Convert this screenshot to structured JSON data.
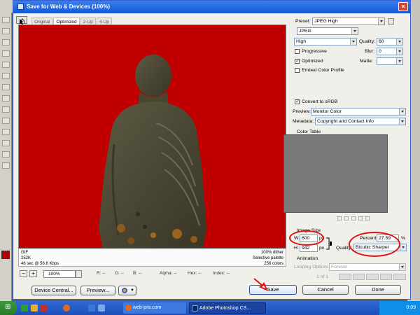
{
  "dialog": {
    "title": "Save for Web & Devices (100%)",
    "tabs": [
      "Original",
      "Optimized",
      "2-Up",
      "4-Up"
    ],
    "active_tab": "Optimized",
    "preview_info": {
      "left": [
        "GIF",
        "252K",
        "46 sec @ 56.6 Kbps"
      ],
      "right": [
        "100% dither",
        "Selective palette",
        "256 colors"
      ]
    },
    "zoom": "100%",
    "stats": {
      "r": "R: --",
      "g": "G: --",
      "b": "B: --",
      "alpha": "Alpha: --",
      "hex": "Hex: --",
      "index": "Index: --"
    },
    "buttons": {
      "device_central": "Device Central...",
      "preview": "Preview...",
      "save": "Save",
      "cancel": "Cancel",
      "done": "Done"
    }
  },
  "settings": {
    "preset_label": "Preset:",
    "preset_value": "JPEG High",
    "format": "JPEG",
    "quality_level": "High",
    "quality_label": "Quality:",
    "quality_value": "60",
    "progressive_label": "Progressive",
    "blur_label": "Blur:",
    "blur_value": "0",
    "optimized_label": "Optimized",
    "matte_label": "Matte:",
    "embed_label": "Embed Color Profile",
    "convert_label": "Convert to sRGB",
    "preview_label": "Preview:",
    "preview_value": "Monitor Color",
    "metadata_label": "Metadata:",
    "metadata_value": "Copyright and Contact Info",
    "color_table_label": "Color Table",
    "image_size_label": "Image Size",
    "w_label": "W:",
    "w_value": "600",
    "h_label": "H:",
    "h_value": "942",
    "px": "px",
    "percent_label": "Percent:",
    "percent_value": "27.59",
    "percent_unit": "%",
    "quality2_label": "Quality:",
    "resample_value": "Bicubic Sharper",
    "animation_label": "Animation",
    "looping_label": "Looping Options:",
    "looping_value": "Forever",
    "frame_counter": "1 of 1"
  },
  "taskbar": {
    "tasks": [
      "web-pra.com",
      "Adobe Photoshop CS..."
    ],
    "clock": "0:09"
  },
  "colors": {
    "preview_bg": "#c00000",
    "accent_red": "#e01010",
    "title_blue": "#1457d6"
  }
}
